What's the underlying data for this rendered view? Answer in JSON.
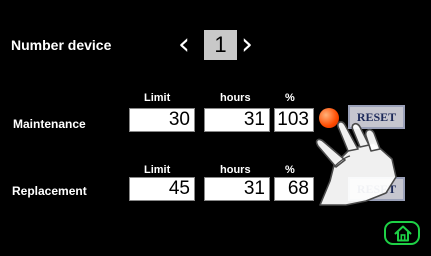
{
  "header": {
    "title": "Number device",
    "device_number": "1"
  },
  "columns": {
    "limit": "Limit",
    "hours": "hours",
    "percent": "%"
  },
  "maintenance": {
    "label": "Maintenance",
    "limit": "30",
    "hours": "31",
    "percent": "103",
    "reset_label": "RESET",
    "alarm_color": "#ff4b00"
  },
  "replacement": {
    "label": "Replacement",
    "limit": "45",
    "hours": "31",
    "percent": "68",
    "reset_label": "RESET"
  },
  "home": {
    "icon": "home-icon",
    "color": "#1ed146"
  },
  "overlay": {
    "icon": "pointing-hand-icon"
  }
}
